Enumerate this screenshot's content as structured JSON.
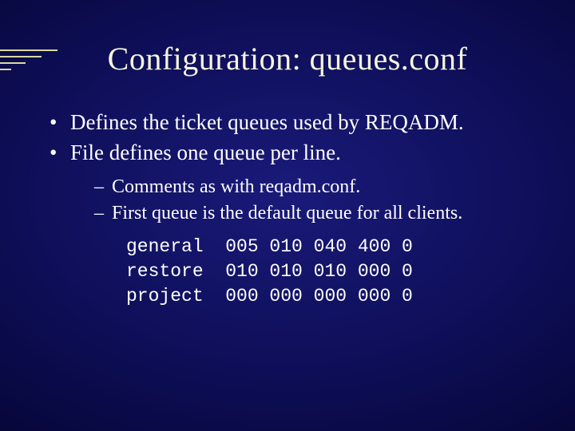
{
  "title": "Configuration: queues.conf",
  "bullets": {
    "b1": "Defines the ticket queues used by REQADM.",
    "b2": "File defines one queue per line."
  },
  "subbullets": {
    "s1": "Comments as with reqadm.conf.",
    "s2": "First queue is the default queue for all clients."
  },
  "code": {
    "line1": "general  005 010 040 400 0",
    "line2": "restore  010 010 010 000 0",
    "line3": "project  000 000 000 000 0"
  }
}
